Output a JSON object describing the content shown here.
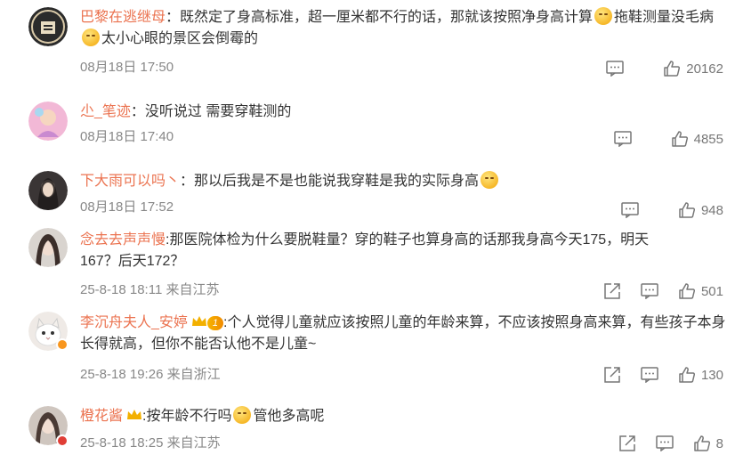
{
  "comments": [
    {
      "username": "巴黎在逃继母",
      "text_a": "：既然定了身高标准，超一厘米都不行的话，那就该按照净身高计算",
      "text_b": "拖鞋测量没毛病",
      "text_c": "太小心眼的景区会倒霉的",
      "time": "08月18日 17:50",
      "likes": "20162"
    },
    {
      "username": "尐_笔迹",
      "text_a": "：没听说过 需要穿鞋测的",
      "time": "08月18日 17:40",
      "likes": "4855"
    },
    {
      "username": "下大雨可以吗丶",
      "text_a": "：那以后我是不是也能说我穿鞋是我的实际身高",
      "time": "08月18日 17:52",
      "likes": "948"
    },
    {
      "username": "念去去声声慢",
      "text_a": ":那医院体检为什么要脱鞋量？穿的鞋子也算身高的话那我身高今天175，明天167？后天172？",
      "time": "25-8-18 18:11 来自江苏",
      "likes": "501"
    },
    {
      "username": "李沉舟夫人_安婷",
      "level": "1",
      "text_a": ":个人觉得儿童就应该按照儿童的年龄来算，不应该按照身高来算，有些孩子本身长得就高，但你不能否认他不是儿童~",
      "time": "25-8-18 19:26 来自浙江",
      "likes": "130"
    },
    {
      "username": "橙花酱",
      "text_a": ":按年龄不行吗",
      "text_b": "管他多高呢",
      "time": "25-8-18 18:25 来自江苏",
      "likes": "8"
    }
  ],
  "icons": [
    "comment-icon",
    "like-icon",
    "share-icon",
    "crown-icon",
    "smile-emoji"
  ],
  "colors": {
    "username": "#eb7350",
    "text": "#333333",
    "meta": "#888888",
    "badge": "#f08a00"
  }
}
